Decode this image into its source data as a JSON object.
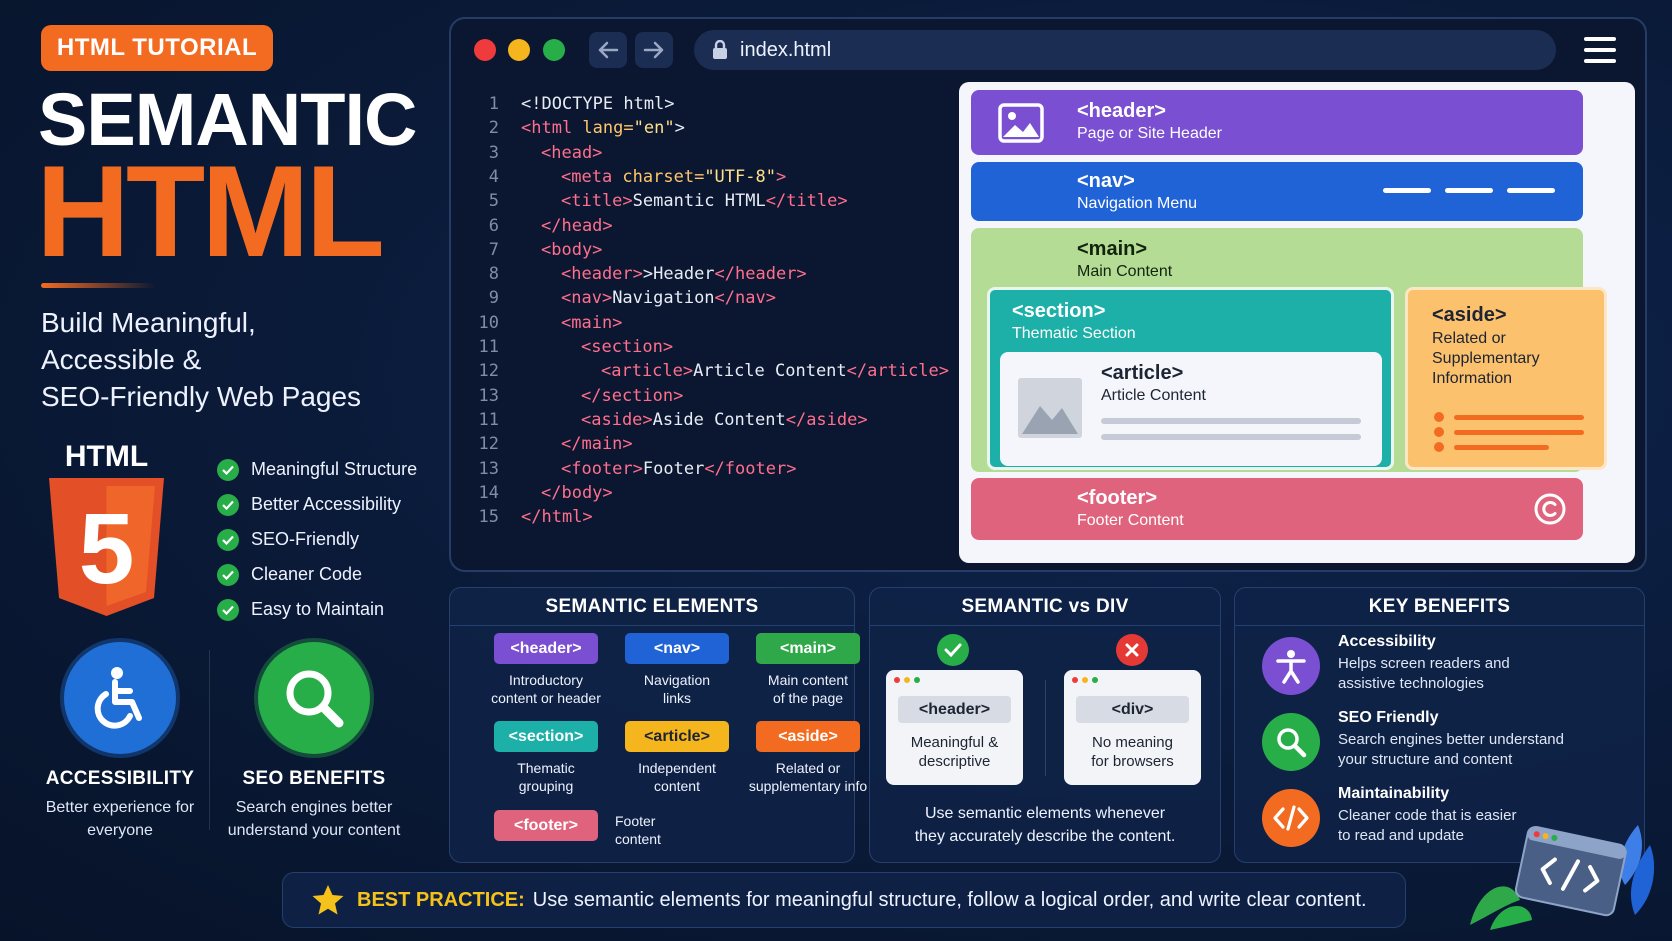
{
  "badge": "HTML TUTORIAL",
  "title_line1": "SEMANTIC",
  "title_line2": "HTML",
  "subtitle": [
    "Build Meaningful,",
    "Accessible &",
    "SEO-Friendly Web Pages"
  ],
  "html5_label": "HTML",
  "html5_digit": "5",
  "checklist": [
    "Meaningful Structure",
    "Better Accessibility",
    "SEO-Friendly",
    "Cleaner Code",
    "Easy to Maintain"
  ],
  "features": [
    {
      "title": "ACCESSIBILITY",
      "desc": [
        "Better experience for",
        "everyone"
      ],
      "icon": "wheelchair-icon",
      "color": "#1f6fd6"
    },
    {
      "title": "SEO BENEFITS",
      "desc": [
        "Search engines better",
        "understand your content"
      ],
      "icon": "magnifier-icon",
      "color": "#27ae48"
    }
  ],
  "browser": {
    "url": "index.html",
    "code_lines": [
      {
        "n": "1",
        "parts": [
          [
            "ct",
            "<!DOCTYPE html>"
          ]
        ],
        "indent": 0
      },
      {
        "n": "2",
        "parts": [
          [
            "tg",
            "<html "
          ],
          [
            "at",
            "lang="
          ],
          [
            "st",
            "\"en\""
          ],
          [
            "ct",
            ">"
          ]
        ],
        "indent": 0
      },
      {
        "n": "3",
        "parts": [
          [
            "tg",
            "<head>"
          ]
        ],
        "indent": 1
      },
      {
        "n": "4",
        "parts": [
          [
            "tg",
            "<meta "
          ],
          [
            "at",
            "charset="
          ],
          [
            "st",
            "\"UTF-8\""
          ],
          [
            "tg",
            ">"
          ]
        ],
        "indent": 2
      },
      {
        "n": "5",
        "parts": [
          [
            "tg",
            "<title>"
          ],
          [
            "ct",
            "Semantic HTML"
          ],
          [
            "tg",
            "</title>"
          ]
        ],
        "indent": 2
      },
      {
        "n": "6",
        "parts": [
          [
            "tg",
            "</head>"
          ]
        ],
        "indent": 1
      },
      {
        "n": "7",
        "parts": [
          [
            "tg",
            "<body>"
          ]
        ],
        "indent": 1
      },
      {
        "n": "8",
        "parts": [
          [
            "tg",
            "<header>"
          ],
          [
            "ct",
            ">Header"
          ],
          [
            "tg",
            "</header>"
          ]
        ],
        "indent": 2
      },
      {
        "n": "9",
        "parts": [
          [
            "tg",
            "<nav>"
          ],
          [
            "ct",
            "Navigation"
          ],
          [
            "tg",
            "</nav>"
          ]
        ],
        "indent": 2
      },
      {
        "n": "10",
        "parts": [
          [
            "tg",
            "<main>"
          ]
        ],
        "indent": 2
      },
      {
        "n": "11",
        "parts": [
          [
            "tg",
            "<section>"
          ]
        ],
        "indent": 3
      },
      {
        "n": "12",
        "parts": [
          [
            "tg",
            "<article>"
          ],
          [
            "ct",
            "Article Content"
          ],
          [
            "tg",
            "</article>"
          ]
        ],
        "indent": 4
      },
      {
        "n": "13",
        "parts": [
          [
            "tg",
            "</section>"
          ]
        ],
        "indent": 3
      },
      {
        "n": "11",
        "parts": [
          [
            "tg",
            "<aside>"
          ],
          [
            "ct",
            "Aside Content"
          ],
          [
            "tg",
            "</aside>"
          ]
        ],
        "indent": 3
      },
      {
        "n": "12",
        "parts": [
          [
            "tg",
            "</main>"
          ]
        ],
        "indent": 2
      },
      {
        "n": "13",
        "parts": [
          [
            "tg",
            "<footer>"
          ],
          [
            "ct",
            "Footer"
          ],
          [
            "tg",
            "</footer>"
          ]
        ],
        "indent": 2
      },
      {
        "n": "14",
        "parts": [
          [
            "tg",
            "</body>"
          ]
        ],
        "indent": 1
      },
      {
        "n": "15",
        "parts": [
          [
            "tg",
            "</html>"
          ]
        ],
        "indent": 0
      }
    ]
  },
  "preview": {
    "header": {
      "tag": "<header>",
      "desc": "Page or Site Header"
    },
    "nav": {
      "tag": "<nav>",
      "desc": "Navigation Menu"
    },
    "main": {
      "tag": "<main>",
      "desc": "Main Content"
    },
    "section": {
      "tag": "<section>",
      "desc": "Thematic Section"
    },
    "article": {
      "tag": "<article>",
      "desc": "Article Content"
    },
    "aside": {
      "tag": "<aside>",
      "desc": [
        "Related or",
        "Supplementary",
        "Information"
      ]
    },
    "footer": {
      "tag": "<footer>",
      "desc": "Footer Content"
    }
  },
  "semantic_elements": {
    "title": "SEMANTIC ELEMENTS",
    "items": [
      {
        "tag": "<header>",
        "desc": [
          "Introductory",
          "content or header"
        ],
        "color": "#7b4fd1"
      },
      {
        "tag": "<nav>",
        "desc": [
          "Navigation",
          "links"
        ],
        "color": "#1f63d6"
      },
      {
        "tag": "<main>",
        "desc": [
          "Main content",
          "of the page"
        ],
        "color": "#2fa84a"
      },
      {
        "tag": "<section>",
        "desc": [
          "Thematic",
          "grouping"
        ],
        "color": "#1cb0a8"
      },
      {
        "tag": "<article>",
        "desc": [
          "Independent",
          "content"
        ],
        "color": "#f5b51c"
      },
      {
        "tag": "<aside>",
        "desc": [
          "Related or",
          "supplementary info"
        ],
        "color": "#f36b21"
      },
      {
        "tag": "<footer>",
        "desc": [
          "Footer",
          "content"
        ],
        "color": "#e0637e"
      }
    ]
  },
  "semantic_vs_div": {
    "title": "SEMANTIC vs DIV",
    "good": {
      "tag": "<header>",
      "desc": [
        "Meaningful &",
        "descriptive"
      ]
    },
    "bad": {
      "tag": "<div>",
      "desc": [
        "No meaning",
        "for browsers"
      ]
    },
    "note": [
      "Use semantic elements whenever",
      "they accurately describe the content."
    ]
  },
  "key_benefits": {
    "title": "KEY BENEFITS",
    "items": [
      {
        "title": "Accessibility",
        "desc": [
          "Helps screen readers and",
          "assistive technologies"
        ],
        "icon": "person-icon",
        "color": "#7b4fd1"
      },
      {
        "title": "SEO Friendly",
        "desc": [
          "Search engines better understand",
          "your structure and content"
        ],
        "icon": "magnifier-icon",
        "color": "#27ae48"
      },
      {
        "title": "Maintainability",
        "desc": [
          "Cleaner code that is easier",
          "to read and update"
        ],
        "icon": "code-icon",
        "color": "#f36b21"
      }
    ]
  },
  "best_practice": {
    "label": "BEST PRACTICE:",
    "text": "Use semantic elements for meaningful structure, follow a logical order, and write clear content."
  },
  "decor_icon": "code-window-icon"
}
